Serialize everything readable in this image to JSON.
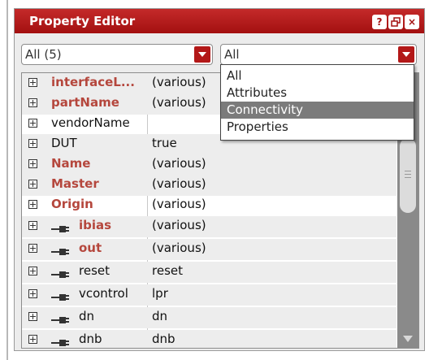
{
  "window": {
    "title": "Property Editor",
    "buttons": [
      {
        "name": "help",
        "glyph": "?"
      },
      {
        "name": "float",
        "glyph": "restore"
      },
      {
        "name": "close",
        "glyph": "×"
      }
    ]
  },
  "filters": {
    "left_dropdown": "All (5)",
    "right_dropdown": "All"
  },
  "dropdown_menu": {
    "options": [
      "All",
      "Attributes",
      "Connectivity",
      "Properties"
    ],
    "highlighted": "Connectivity"
  },
  "rows": [
    {
      "name": "interfaceL...",
      "value": "(various)"
    },
    {
      "name": "partName",
      "value": "(various)"
    },
    {
      "name": "vendorName",
      "value": ""
    },
    {
      "name": "DUT",
      "value": "true"
    },
    {
      "name": "Name",
      "value": "(various)"
    },
    {
      "name": "Master",
      "value": "(various)"
    },
    {
      "name": "Origin",
      "value": "(various)"
    },
    {
      "name": "ibias",
      "value": "(various)"
    },
    {
      "name": "out",
      "value": "(various)"
    },
    {
      "name": "reset",
      "value": "reset"
    },
    {
      "name": "vcontrol",
      "value": "lpr"
    },
    {
      "name": "dn",
      "value": "dn"
    },
    {
      "name": "dnb",
      "value": "dnb"
    }
  ],
  "colors": {
    "title_bar": "#b31818",
    "varied_property_text": "#b5473d",
    "highlight": "#7b7b7b"
  }
}
